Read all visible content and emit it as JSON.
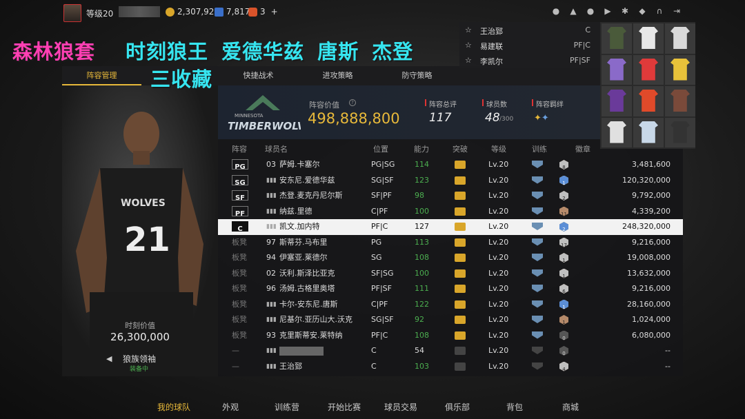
{
  "topbar": {
    "level": "等级20",
    "coins": "2,307,922",
    "stars": "7,817",
    "tokens": "3",
    "plus": "+"
  },
  "overlay": {
    "line1_a": "森林狼套",
    "line1_b": "时刻狼王 爱德华兹 唐斯 杰登",
    "line2": "三收藏"
  },
  "tabs": [
    "阵容管理",
    "快捷战术",
    "进攻策略",
    "防守策略"
  ],
  "dropdown": {
    "players": [
      "王治郅",
      "易建联",
      "李凯尔"
    ],
    "positions": [
      "C",
      "PF|C",
      "PF|SF"
    ]
  },
  "team": {
    "logo_city": "MINNESOTA",
    "logo_name": "TIMBERWOLVES",
    "value_label": "阵容价值",
    "value": "498,888,800",
    "overall_label": "阵容总评",
    "overall": "117",
    "count_label": "球员数",
    "count": "48",
    "count_max": "/300",
    "synergy_label": "阵容羁绊"
  },
  "columns": [
    "阵容",
    "球员名",
    "位置",
    "能力",
    "突破",
    "等级",
    "训练",
    "徽章"
  ],
  "rows": [
    {
      "slot": "PG",
      "num": "03",
      "name": "萨姆.卡塞尔",
      "pos": "PG|SG",
      "ovr": "114",
      "lv": "Lv.20",
      "badges": [
        [
          "hb",
          "2"
        ],
        [
          "hs",
          "8"
        ]
      ],
      "value": "3,481,600"
    },
    {
      "slot": "SG",
      "num": "",
      "name": "安东尼.爱德华兹",
      "pos": "SG|SF",
      "ovr": "123",
      "lv": "Lv.20",
      "badges": [
        [
          "hb",
          "10"
        ],
        [
          "hs",
          "15"
        ],
        [
          "hg",
          "1"
        ],
        [
          "hbl",
          "1"
        ]
      ],
      "value": "120,320,000"
    },
    {
      "slot": "SF",
      "num": "",
      "name": "杰登.麦克丹尼尔斯",
      "pos": "SF|PF",
      "ovr": "98",
      "lv": "Lv.20",
      "badges": [
        [
          "hb",
          "5"
        ],
        [
          "hs",
          "2"
        ]
      ],
      "value": "9,792,000"
    },
    {
      "slot": "PF",
      "num": "",
      "name": "纳兹.里德",
      "pos": "C|PF",
      "ovr": "100",
      "lv": "Lv.20",
      "badges": [
        [
          "hb",
          "11"
        ]
      ],
      "value": "4,339,200"
    },
    {
      "slot": "C",
      "num": "",
      "name": "凯文.加内特",
      "pos": "PF|C",
      "ovr": "127",
      "lv": "Lv.20",
      "badges": [
        [
          "hb",
          "2"
        ],
        [
          "hs",
          "20"
        ],
        [
          "hg",
          "2"
        ],
        [
          "hbl",
          "2"
        ]
      ],
      "value": "248,320,000"
    },
    {
      "slot": "板凳",
      "num": "97",
      "name": "斯蒂芬.马布里",
      "pos": "PG",
      "ovr": "113",
      "lv": "Lv.20",
      "badges": [
        [
          "hb",
          "8"
        ],
        [
          "hs",
          "17"
        ]
      ],
      "value": "9,216,000"
    },
    {
      "slot": "板凳",
      "num": "94",
      "name": "伊塞亚.莱德尔",
      "pos": "SG",
      "ovr": "108",
      "lv": "Lv.20",
      "badges": [
        [
          "hb",
          "5"
        ],
        [
          "hs",
          "1"
        ]
      ],
      "value": "19,008,000"
    },
    {
      "slot": "板凳",
      "num": "02",
      "name": "沃利.斯泽比亚克",
      "pos": "SF|SG",
      "ovr": "100",
      "lv": "Lv.20",
      "badges": [
        [
          "hb",
          "1"
        ],
        [
          "hs",
          "1"
        ]
      ],
      "value": "13,632,000"
    },
    {
      "slot": "板凳",
      "num": "96",
      "name": "汤姆.古格里奥塔",
      "pos": "PF|SF",
      "ovr": "111",
      "lv": "Lv.20",
      "badges": [
        [
          "hb",
          "1"
        ],
        [
          "hs",
          "6"
        ]
      ],
      "value": "9,216,000"
    },
    {
      "slot": "板凳",
      "num": "",
      "name": "卡尔-安东尼.唐斯",
      "pos": "C|PF",
      "ovr": "122",
      "lv": "Lv.20",
      "badges": [
        [
          "hb",
          "7"
        ],
        [
          "hs",
          "5"
        ],
        [
          "hbl",
          "1"
        ]
      ],
      "value": "28,160,000"
    },
    {
      "slot": "板凳",
      "num": "",
      "name": "尼基尔.亚历山大.沃克",
      "pos": "SG|SF",
      "ovr": "92",
      "lv": "Lv.20",
      "badges": [
        [
          "hb",
          "1"
        ]
      ],
      "value": "1,024,000"
    },
    {
      "slot": "板凳",
      "num": "93",
      "name": "克里斯蒂安.莱特纳",
      "pos": "PF|C",
      "ovr": "108",
      "lv": "Lv.20",
      "badges": [
        [
          "hb",
          "7"
        ],
        [
          "hs",
          "12"
        ],
        [
          "hd",
          "0"
        ]
      ],
      "value": "6,080,000"
    },
    {
      "slot": "—",
      "num": "",
      "name": "",
      "pos": "C",
      "ovr": "54",
      "lv": "Lv.20",
      "badges": [
        [
          "hd",
          "0"
        ],
        [
          "hd",
          "0"
        ]
      ],
      "value": "--"
    },
    {
      "slot": "—",
      "num": "",
      "name": "王治郅",
      "pos": "C",
      "ovr": "103",
      "lv": "Lv.20",
      "badges": [
        [
          "hb",
          "6"
        ],
        [
          "hs",
          "4"
        ]
      ],
      "value": "--"
    }
  ],
  "left": {
    "value_label": "时刻价值",
    "value": "26,300,000",
    "item": "狼族领袖",
    "item_status": "装备中",
    "jersey_number": "21",
    "jersey_team": "WOLVES"
  },
  "bottomnav": [
    "我的球队",
    "外观",
    "训练营",
    "开始比赛",
    "球员交易",
    "俱乐部",
    "背包",
    "商城"
  ],
  "colors": {
    "accent": "#e8b93a",
    "green": "#4caf50",
    "pink": "#ff3fb3",
    "cyan": "#36e5f0"
  }
}
